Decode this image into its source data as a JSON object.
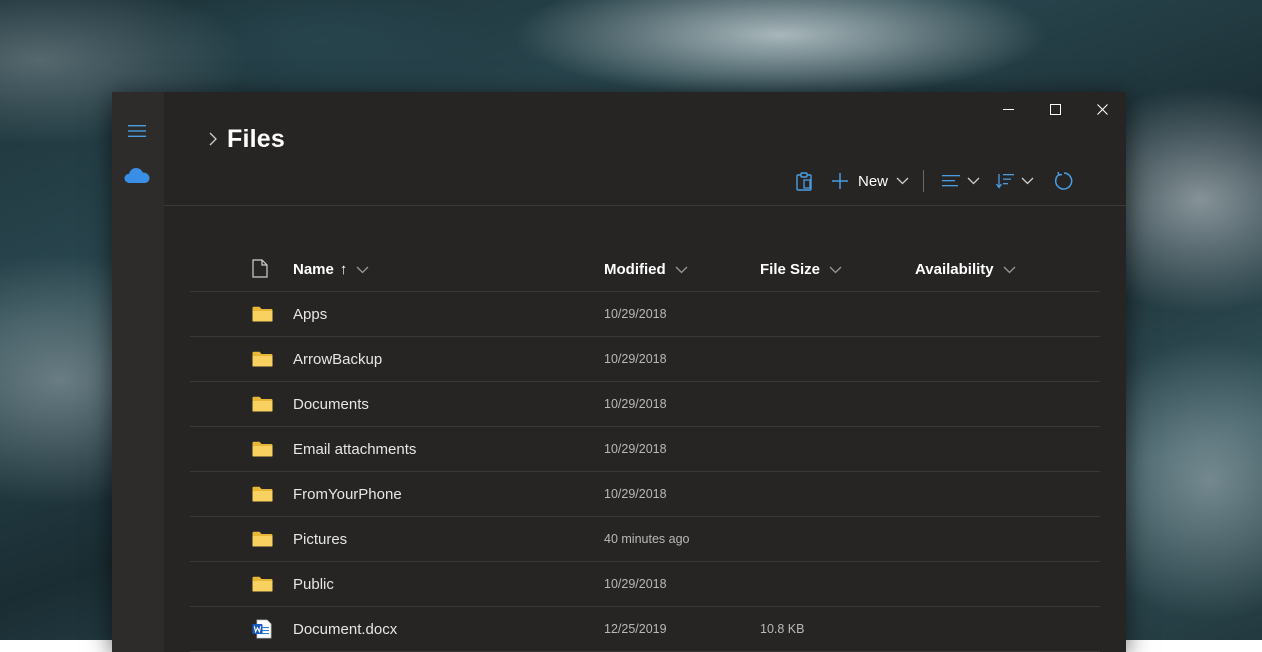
{
  "window": {
    "accent_color": "#4a9de0",
    "folder_color": "#f4c542"
  },
  "caption": {
    "minimize_icon": "minimize-icon",
    "maximize_icon": "maximize-icon",
    "close_icon": "close-icon"
  },
  "rail": {
    "menu_icon": "hamburger-icon",
    "account_icon": "onedrive-cloud-icon"
  },
  "header": {
    "breadcrumb_icon": "chevron-right-icon",
    "title": "Files"
  },
  "toolbar": {
    "paste_icon": "clipboard-icon",
    "new_label": "New",
    "view_icon": "view-lines-icon",
    "sort_icon": "sort-icon",
    "refresh_icon": "refresh-icon"
  },
  "columns": {
    "name": "Name",
    "name_sort_indicator": "↑",
    "modified": "Modified",
    "file_size": "File Size",
    "availability": "Availability"
  },
  "files": [
    {
      "name": "Apps",
      "modified": "10/29/2018",
      "size": "",
      "type": "folder"
    },
    {
      "name": "ArrowBackup",
      "modified": "10/29/2018",
      "size": "",
      "type": "folder"
    },
    {
      "name": "Documents",
      "modified": "10/29/2018",
      "size": "",
      "type": "folder"
    },
    {
      "name": "Email attachments",
      "modified": "10/29/2018",
      "size": "",
      "type": "folder"
    },
    {
      "name": "FromYourPhone",
      "modified": "10/29/2018",
      "size": "",
      "type": "folder"
    },
    {
      "name": "Pictures",
      "modified": "40 minutes ago",
      "size": "",
      "type": "folder"
    },
    {
      "name": "Public",
      "modified": "10/29/2018",
      "size": "",
      "type": "folder"
    },
    {
      "name": "Document.docx",
      "modified": "12/25/2019",
      "size": "10.8 KB",
      "type": "word"
    }
  ]
}
